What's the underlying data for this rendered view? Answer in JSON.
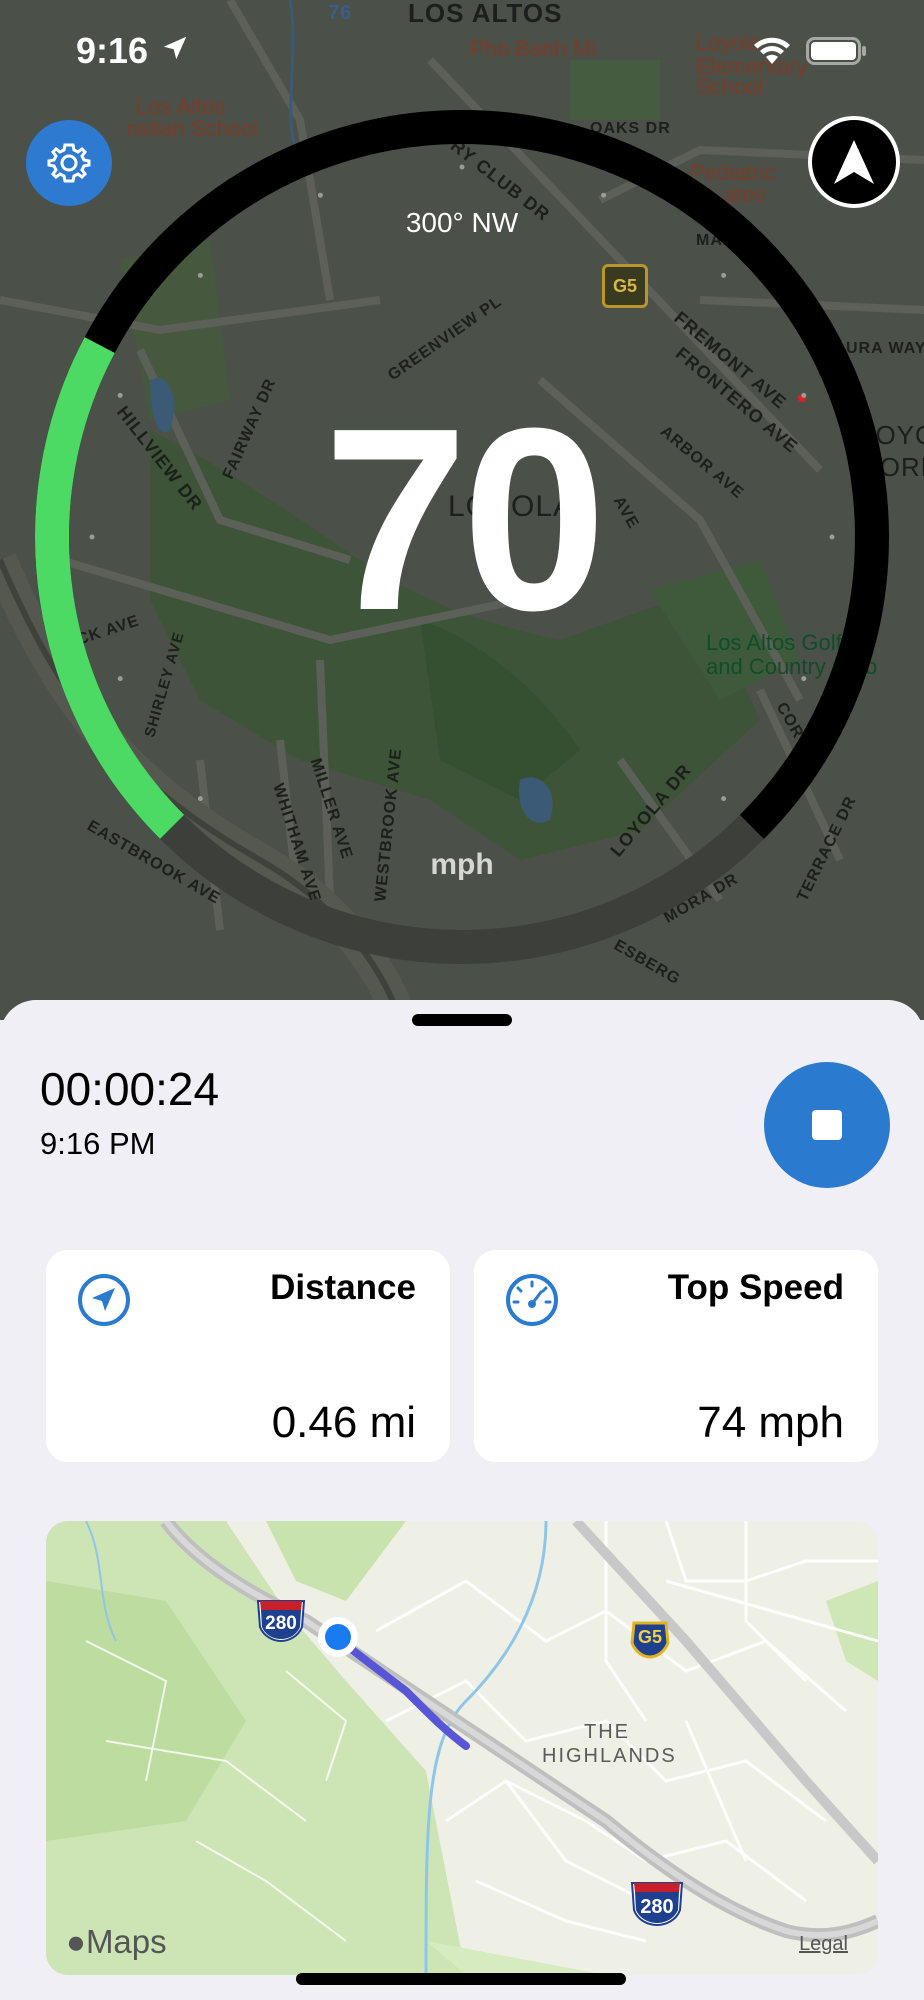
{
  "status_bar": {
    "time": "9:16"
  },
  "map_labels": {
    "los_altos": "LOS ALTOS",
    "pho_banh_mi": "Pho Banh Mi",
    "school_1": "Loyola",
    "school_2": "Elementary",
    "school_3": "School",
    "christian_1": "Los Altos",
    "christian_2": "ristian School",
    "oaks": "OAKS DR",
    "country_club": "RY CLUB DR",
    "pediatric_1": "Pediatric",
    "pediatric_2": "ates",
    "manor": "MANOR",
    "greenview": "GREENVIEW PL",
    "fremont": "FREMONT AVE",
    "frontero": "FRONTERO AVE",
    "ura_way": "URA WAY",
    "hillview": "HILLVIEW DR",
    "fairway": "FAIRWAY DR",
    "arbor": "ARBOR AVE",
    "loyola_center": "LOYOLA",
    "corners": "CORNER",
    "loyola_area": "LOYOLA",
    "ave_mid": "AVE",
    "ck_ave": "CK AVE",
    "shirley": "SHIRLEY AVE",
    "golf_1": "Los Altos Golf",
    "golf_2": "and Country Club",
    "cor": "COR",
    "miller": "MILLER AVE",
    "whitham": "WHITHAM AVE",
    "westbrook": "WESTBROOK AVE",
    "loyola_dr": "LOYOLA DR",
    "terrace": "TERRACE DR",
    "eastbrook": "EASTBROOK AVE",
    "mora": "MORA DR",
    "esberg": "ESBERG",
    "route_76": "76",
    "g5": "G5"
  },
  "gauge": {
    "heading": "300° NW",
    "speed": "70",
    "unit": "mph",
    "speed_fraction": 0.27,
    "colors": {
      "active": "#4cd964",
      "track": "#000000",
      "dim": "#3c3f3a"
    }
  },
  "buttons": {
    "settings_icon": "gear-icon",
    "navigation_icon": "navigation-arrow-icon",
    "stop_icon": "stop-icon"
  },
  "sheet": {
    "elapsed": "00:00:24",
    "clock": "9:16 PM",
    "cards": [
      {
        "title": "Distance",
        "value": "0.46 mi",
        "icon": "location-arrow-icon"
      },
      {
        "title": "Top Speed",
        "value": "74 mph",
        "icon": "speedometer-icon"
      }
    ]
  },
  "mini_map": {
    "highway_1": "280",
    "highway_2": "280",
    "route_g5": "G5",
    "area_1": "THE",
    "area_2": "HIGHLANDS",
    "logo": "Maps",
    "legal": "Legal",
    "route_color": "#5856d6",
    "dot_color": "#1a7bf0"
  },
  "colors": {
    "accent": "#2d7ad0",
    "sheet_bg": "#f0eff5"
  }
}
